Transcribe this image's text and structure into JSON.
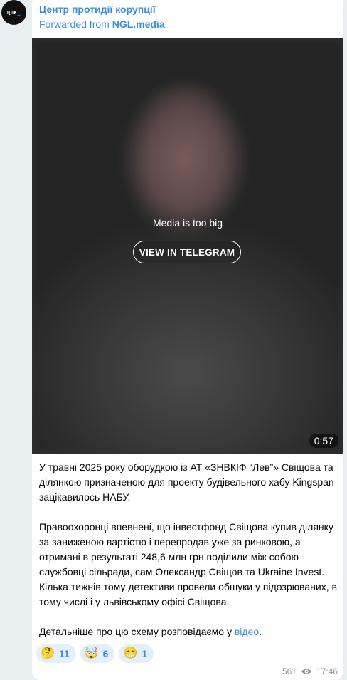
{
  "channel": {
    "avatar_text": "ЦПК",
    "avatar_cursor": "_",
    "name": "Центр протидії корупції_",
    "forwarded_prefix": "Forwarded from ",
    "forwarded_source": "NGL.media"
  },
  "media": {
    "message": "Media is too big",
    "button_label": "VIEW IN TELEGRAM",
    "duration": "0:57"
  },
  "post": {
    "paragraph_1": "У травні 2025 року оборудкою із АТ «ЗНВКІФ “Лев”» Свіщова та ділянкою призначеною для проекту будівельного хабу Kingspan зацікавилось НАБУ.",
    "paragraph_2": "Правоохоронці впевнені, що інвестфонд Свіщова купив ділянку за заниженою вартістю і перепродав уже за ринковою, а отримані в результаті 248,6 млн грн поділили між собою службовці сільради, сам Олександр Свіщов та Ukraine Invest. Кілька тижнів тому детективи провели обшуки у підозрюваних, в тому числі і у львівському офісі Свіщова.",
    "paragraph_3_prefix": "Детальніше про цю схему розповідаємо у ",
    "paragraph_3_link": "відео",
    "paragraph_3_suffix": "."
  },
  "reactions": [
    {
      "emoji": "🤔",
      "count": "11"
    },
    {
      "emoji": "🤯",
      "count": "6"
    },
    {
      "emoji": "😁",
      "count": "1"
    }
  ],
  "meta": {
    "views": "561",
    "time": "17:46",
    "icon": "eye-icon"
  },
  "colors": {
    "accent": "#3a8ed8",
    "background": "#e9eef1",
    "bubble": "#ffffff",
    "reaction_bg": "#e3f0fb"
  }
}
